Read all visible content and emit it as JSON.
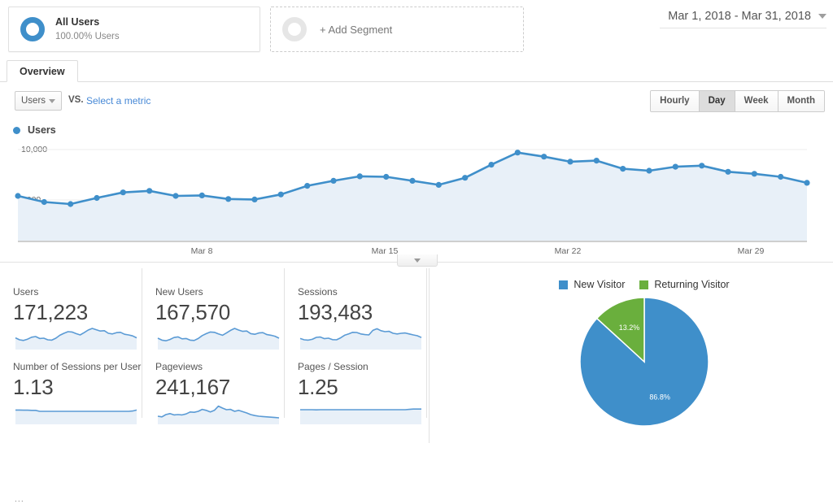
{
  "segment": {
    "all_users": {
      "title": "All Users",
      "subtitle": "100.00% Users",
      "icon": "donut-icon"
    },
    "add_segment": {
      "label": "+ Add Segment",
      "icon": "donut-empty-icon"
    }
  },
  "date_range": {
    "label": "Mar 1, 2018 - Mar 31, 2018",
    "icon": "chevron-down-icon"
  },
  "tabs": [
    {
      "label": "Overview",
      "active": true
    }
  ],
  "metric_selector": {
    "selected_metric": "Users",
    "vs_label": "VS.",
    "select_metric_link": "Select a metric",
    "caret_icon": "chevron-down-icon"
  },
  "granularity": {
    "options": [
      "Hourly",
      "Day",
      "Week",
      "Month"
    ],
    "selected": "Day"
  },
  "chart_legend": {
    "label": "Users",
    "color": "#3f8fca"
  },
  "collapse_handle": {
    "icon": "chevron-down-icon"
  },
  "chart_data": {
    "type": "line",
    "title": "Users",
    "xlabel": "",
    "ylabel": "Users",
    "ylim": [
      0,
      12500
    ],
    "yticks": [
      5000,
      10000
    ],
    "ytick_labels": [
      "5,000",
      "10,000"
    ],
    "xtick_labels": [
      "...",
      "Mar 8",
      "Mar 15",
      "Mar 22",
      "Mar 29"
    ],
    "grid": true,
    "legend_position": "top-left",
    "line_color": "#3f8fca",
    "fill_color": "#e8f0f8",
    "x": [
      "Mar 1",
      "Mar 2",
      "Mar 3",
      "Mar 4",
      "Mar 5",
      "Mar 6",
      "Mar 7",
      "Mar 8",
      "Mar 9",
      "Mar 10",
      "Mar 11",
      "Mar 12",
      "Mar 13",
      "Mar 14",
      "Mar 15",
      "Mar 16",
      "Mar 17",
      "Mar 18",
      "Mar 19",
      "Mar 20",
      "Mar 21",
      "Mar 22",
      "Mar 23",
      "Mar 24",
      "Mar 25",
      "Mar 26",
      "Mar 27",
      "Mar 28",
      "Mar 29",
      "Mar 30",
      "Mar 31"
    ],
    "values": [
      5400,
      4800,
      4600,
      5200,
      5750,
      5900,
      5400,
      5450,
      5100,
      5050,
      5550,
      6400,
      6900,
      7350,
      7300,
      6900,
      6500,
      7200,
      8500,
      9700,
      9300,
      8800,
      8900,
      8100,
      7900,
      8300,
      8400,
      7800,
      7600,
      7300,
      6700
    ]
  },
  "cards": [
    {
      "title": "Users",
      "value": "171,223",
      "sparkline": [
        0.42,
        0.3,
        0.26,
        0.34,
        0.46,
        0.5,
        0.38,
        0.4,
        0.3,
        0.28,
        0.4,
        0.58,
        0.7,
        0.8,
        0.78,
        0.68,
        0.6,
        0.74,
        0.9,
        1.0,
        0.92,
        0.84,
        0.86,
        0.7,
        0.66,
        0.74,
        0.76,
        0.64,
        0.6,
        0.54,
        0.42
      ]
    },
    {
      "title": "New Users",
      "value": "167,570",
      "sparkline": [
        0.4,
        0.28,
        0.24,
        0.32,
        0.44,
        0.48,
        0.36,
        0.38,
        0.28,
        0.26,
        0.38,
        0.56,
        0.68,
        0.78,
        0.76,
        0.66,
        0.58,
        0.72,
        0.88,
        1.0,
        0.9,
        0.82,
        0.84,
        0.68,
        0.64,
        0.72,
        0.74,
        0.62,
        0.58,
        0.52,
        0.4
      ]
    },
    {
      "title": "Sessions",
      "value": "193,483",
      "sparkline": [
        0.38,
        0.3,
        0.28,
        0.33,
        0.45,
        0.47,
        0.37,
        0.4,
        0.31,
        0.3,
        0.42,
        0.58,
        0.66,
        0.76,
        0.75,
        0.66,
        0.62,
        0.6,
        0.88,
        0.98,
        0.86,
        0.8,
        0.82,
        0.7,
        0.66,
        0.7,
        0.72,
        0.66,
        0.6,
        0.55,
        0.44
      ]
    },
    {
      "title": "Number of Sessions per User",
      "value": "1.13",
      "sparkline": [
        0.58,
        0.58,
        0.57,
        0.57,
        0.56,
        0.56,
        0.5,
        0.5,
        0.5,
        0.5,
        0.5,
        0.5,
        0.5,
        0.5,
        0.5,
        0.5,
        0.5,
        0.5,
        0.5,
        0.5,
        0.5,
        0.5,
        0.5,
        0.5,
        0.5,
        0.5,
        0.5,
        0.5,
        0.5,
        0.52,
        0.58
      ]
    },
    {
      "title": "Pageviews",
      "value": "241,167",
      "sparkline": [
        0.2,
        0.16,
        0.3,
        0.36,
        0.28,
        0.3,
        0.28,
        0.34,
        0.46,
        0.44,
        0.5,
        0.62,
        0.56,
        0.46,
        0.56,
        0.82,
        0.7,
        0.6,
        0.62,
        0.5,
        0.56,
        0.48,
        0.4,
        0.3,
        0.24,
        0.2,
        0.18,
        0.16,
        0.14,
        0.12,
        0.1
      ]
    },
    {
      "title": "Pages / Session",
      "value": "1.25",
      "sparkline": [
        0.6,
        0.6,
        0.6,
        0.6,
        0.59,
        0.6,
        0.6,
        0.6,
        0.6,
        0.6,
        0.6,
        0.6,
        0.6,
        0.6,
        0.6,
        0.6,
        0.6,
        0.6,
        0.6,
        0.6,
        0.6,
        0.6,
        0.6,
        0.6,
        0.6,
        0.6,
        0.6,
        0.62,
        0.64,
        0.64,
        0.64
      ]
    }
  ],
  "pie": {
    "legend": [
      {
        "label": "New Visitor",
        "color": "#3f8fca"
      },
      {
        "label": "Returning Visitor",
        "color": "#6aaf3d"
      }
    ],
    "chart_data": {
      "type": "pie",
      "labels": [
        "New Visitor",
        "Returning Visitor"
      ],
      "values": [
        86.8,
        13.2
      ],
      "data_labels": [
        "86.8%",
        "13.2%"
      ],
      "colors": [
        "#3f8fca",
        "#6aaf3d"
      ],
      "legend_position": "top"
    }
  }
}
